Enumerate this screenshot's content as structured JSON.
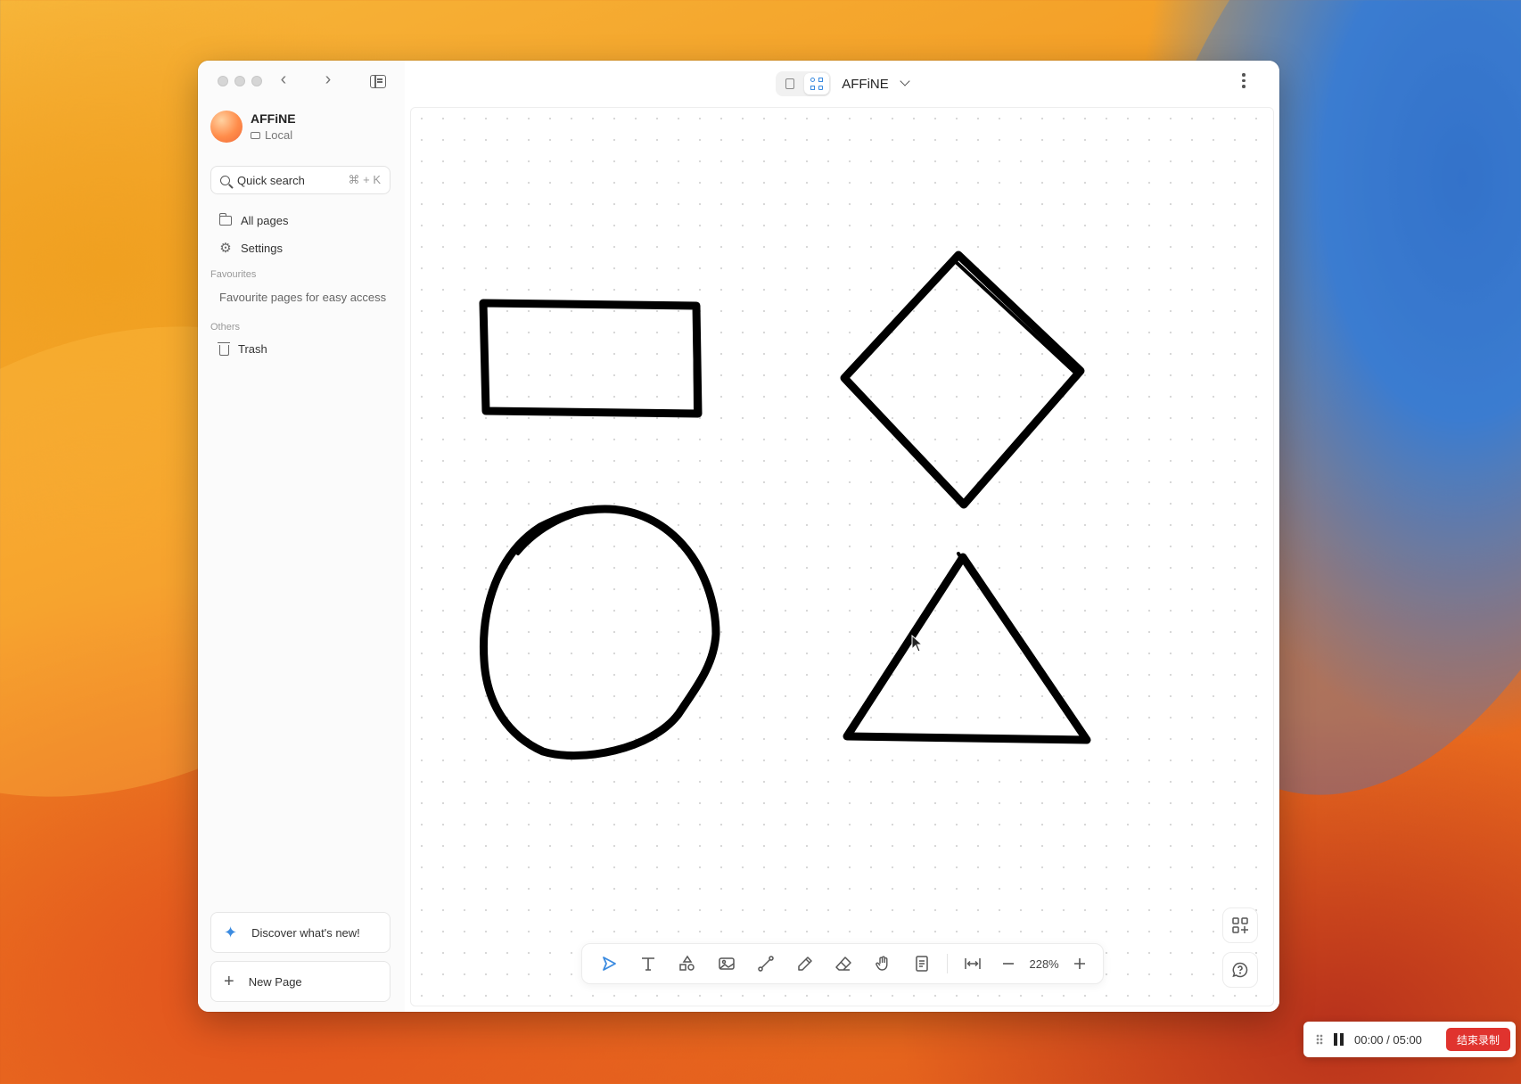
{
  "sidebar": {
    "workspace": {
      "name": "AFFiNE",
      "storage": "Local"
    },
    "search": {
      "label": "Quick search",
      "shortcut": "⌘ + K"
    },
    "items": [
      {
        "label": "All pages",
        "icon": "folder-icon"
      },
      {
        "label": "Settings",
        "icon": "gear-icon"
      }
    ],
    "favourites": {
      "title": "Favourites",
      "placeholder": "Favourite pages for easy access"
    },
    "others": {
      "title": "Others",
      "items": [
        {
          "label": "Trash",
          "icon": "trash-icon"
        }
      ]
    },
    "discover_label": "Discover what's new!",
    "new_page_label": "New Page"
  },
  "header": {
    "title": "AFFiNE",
    "modes": [
      "page-mode-icon",
      "edgeless-mode-icon"
    ],
    "active_mode": "edgeless"
  },
  "canvas": {
    "shapes": [
      "rectangle",
      "diamond",
      "circle",
      "triangle"
    ],
    "stroke_color": "#000000"
  },
  "toolbar": {
    "tools": [
      "select-icon",
      "text-icon",
      "shapes-icon",
      "image-icon",
      "connector-icon",
      "pen-icon",
      "eraser-icon",
      "hand-icon",
      "note-icon"
    ],
    "active_tool": "select-icon",
    "zoom": "228%"
  },
  "recorder": {
    "time": "00:00 / 05:00",
    "stop_label": "结束录制"
  },
  "colors": {
    "accent": "#3b8be0",
    "stop": "#e0332e"
  }
}
